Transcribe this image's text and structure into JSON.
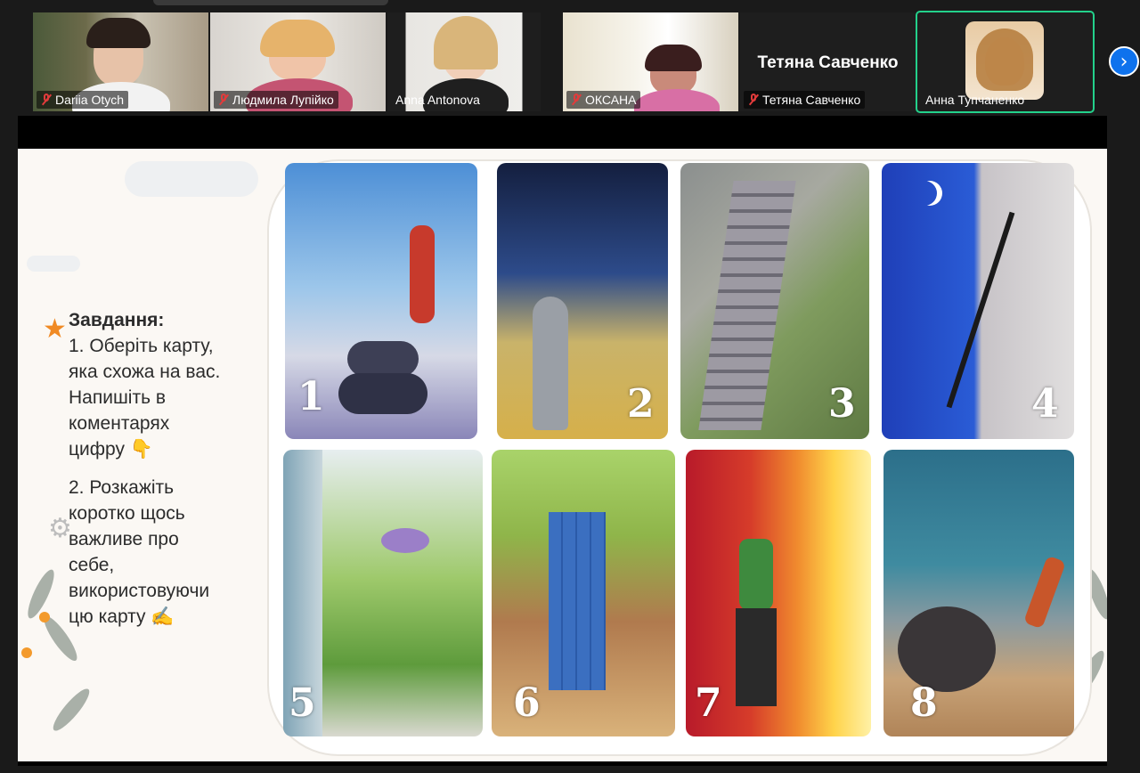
{
  "participants": [
    {
      "name": "Dariia Otych",
      "muted": true
    },
    {
      "name": "Людмила Лупійко",
      "muted": true
    },
    {
      "name": "Anna Antonova",
      "muted": false
    },
    {
      "name": "ОКСАНА",
      "muted": true
    },
    {
      "name": "Тетяна Савченко",
      "muted": true,
      "video_off": true,
      "display_name": "Тетяна Савченко"
    },
    {
      "name": "Анна Тупчаненко",
      "muted": false,
      "active_speaker": true
    }
  ],
  "colors": {
    "active_speaker_border": "#23d18b",
    "next_button": "#0e72ed",
    "muted_icon": "#e23b3b"
  },
  "slide": {
    "task_title": "Завдання:",
    "task_1": [
      "1. Оберіть карту,",
      "яка схожа на вас.",
      "Напишіть в",
      "коментарях",
      "цифру 👇"
    ],
    "task_2": [
      "2. Розкажіть",
      "коротко щось",
      "важливе про",
      "себе,",
      "використовуючи",
      "цю карту ✍"
    ],
    "cards": [
      "1",
      "2",
      "3",
      "4",
      "5",
      "6",
      "7",
      "8"
    ]
  }
}
